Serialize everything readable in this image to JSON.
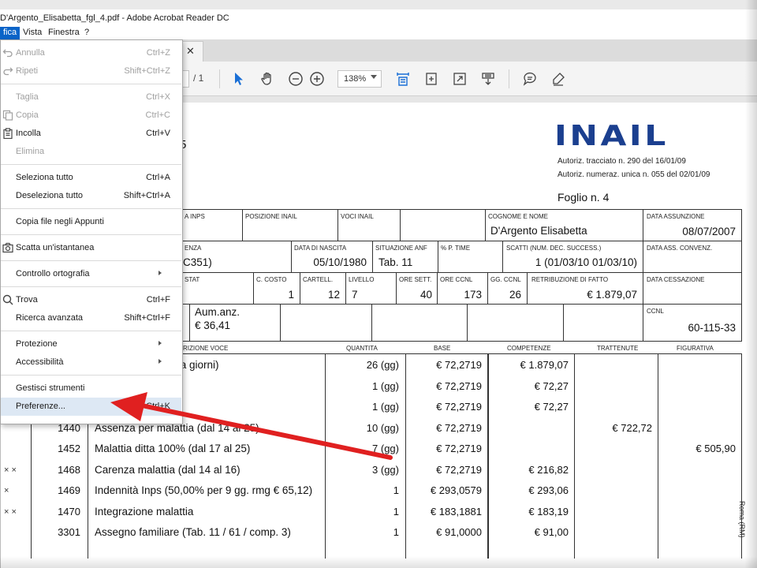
{
  "window": {
    "title": "D'Argento_Elisabetta_fgl_4.pdf - Adobe Acrobat Reader DC"
  },
  "menubar": {
    "items": [
      "fica",
      "Vista",
      "Finestra",
      "?"
    ]
  },
  "toolbar": {
    "page_total": "/ 1",
    "zoom": "138%"
  },
  "edit_menu": {
    "items": [
      {
        "label": "Annulla",
        "shortcut": "Ctrl+Z",
        "enabled": false,
        "icon": "undo-icon"
      },
      {
        "label": "Ripeti",
        "shortcut": "Shift+Ctrl+Z",
        "enabled": false,
        "icon": "redo-icon"
      },
      {
        "label": "Taglia",
        "shortcut": "Ctrl+X",
        "enabled": false
      },
      {
        "label": "Copia",
        "shortcut": "Ctrl+C",
        "enabled": false,
        "icon": "copy-icon"
      },
      {
        "label": "Incolla",
        "shortcut": "Ctrl+V",
        "enabled": true,
        "icon": "paste-icon"
      },
      {
        "label": "Elimina",
        "shortcut": "",
        "enabled": false
      },
      {
        "label": "Seleziona tutto",
        "shortcut": "Ctrl+A",
        "enabled": true
      },
      {
        "label": "Deseleziona tutto",
        "shortcut": "Shift+Ctrl+A",
        "enabled": true
      },
      {
        "label": "Copia file negli Appunti",
        "shortcut": "",
        "enabled": true
      },
      {
        "label": "Scatta un'istantanea",
        "shortcut": "",
        "enabled": true,
        "icon": "camera-icon"
      },
      {
        "label": "Controllo ortografia",
        "shortcut": "",
        "enabled": true,
        "submenu": true
      },
      {
        "label": "Trova",
        "shortcut": "Ctrl+F",
        "enabled": true,
        "icon": "search-icon"
      },
      {
        "label": "Ricerca avanzata",
        "shortcut": "Shift+Ctrl+F",
        "enabled": true
      },
      {
        "label": "Protezione",
        "shortcut": "",
        "enabled": true,
        "submenu": true
      },
      {
        "label": "Accessibilità",
        "shortcut": "",
        "enabled": true,
        "submenu": true
      },
      {
        "label": "Gestisci strumenti",
        "shortcut": "",
        "enabled": true
      },
      {
        "label": "Preferenze...",
        "shortcut": "Ctrl+K",
        "enabled": true,
        "highlighted": true
      }
    ]
  },
  "document": {
    "logo": "INAIL",
    "authorizations": [
      "Autoriz. tracciato n. 290 del 16/01/09",
      "Autoriz. numeraz. unica n. 055 del 02/01/09"
    ],
    "foglio": "Foglio n.  4",
    "left_fragment": "5",
    "header": {
      "h_inps": "A INPS",
      "h_pos_inail": "POSIZIONE INAIL",
      "h_voci_inail": "VOCI INAIL",
      "h_cognome": "COGNOME E NOME",
      "v_cognome": "D'Argento Elisabetta",
      "h_assunzione": "DATA  ASSUNZIONE",
      "v_assunzione": "08/07/2007",
      "h_enza": "ENZA",
      "v_c351": "C351)",
      "h_nascita": "DATA DI NASCITA",
      "v_nascita": "05/10/1980",
      "h_anf": "SITUAZIONE ANF",
      "v_anf": "Tab. 11",
      "h_ptime": "% P. TIME",
      "h_scatti": "SCATTI (NUM. DEC. SUCCESS.)",
      "v_scatti": "1 (01/03/10 01/03/10)",
      "h_ass_conv": "DATA ASS. CONVENZ.",
      "h_stat": "STAT",
      "h_costo": "C. COSTO",
      "v_costo": "1",
      "h_cartell": "CARTELL.",
      "v_cartell": "12",
      "h_livello": "LIVELLO",
      "v_livello": "7",
      "h_ore_sett": "ORE SETT.",
      "v_ore_sett": "40",
      "h_ore_ccnl": "ORE CCNL",
      "v_ore_ccnl": "173",
      "h_gg_ccnl": "GG. CCNL",
      "v_gg_ccnl": "26",
      "h_retribuzione": "RETRIBUZIONE DI FATTO",
      "v_retribuzione": "€ 1.879,07",
      "h_cessazione": "DATA CESSAZIONE",
      "v_aum_label": "Aum.anz.",
      "v_aum_value": "€ 36,41",
      "h_ccnl": "CCNL",
      "v_ccnl": "60-115-33"
    },
    "columns": [
      "RIZIONE VOCE",
      "QUANTITA",
      "BASE",
      "COMPETENZE",
      "TRATTENUTE",
      "FIGURATIVA"
    ],
    "rows": [
      {
        "x": "",
        "code": "",
        "desc": "aria (mensilizzata a giorni)",
        "qty": "26 (gg)",
        "base": "€ 72,2719",
        "comp": "€ 1.879,07",
        "tratt": "",
        "fig": ""
      },
      {
        "x": "",
        "code": "",
        "desc": "5 Aprile)",
        "qty": "1 (gg)",
        "base": "€ 72,2719",
        "comp": "€ 72,27",
        "tratt": "",
        "fig": ""
      },
      {
        "x": "",
        "code": "",
        "desc": "5 Aprile)",
        "qty": "1 (gg)",
        "base": "€ 72,2719",
        "comp": "€ 72,27",
        "tratt": "",
        "fig": ""
      },
      {
        "x": "",
        "code": "1440",
        "desc": "Assenza per malattia (dal 14 al 25)",
        "qty": "10 (gg)",
        "base": "€ 72,2719",
        "comp": "",
        "tratt": "€ 722,72",
        "fig": ""
      },
      {
        "x": "",
        "code": "1452",
        "desc": "Malattia ditta 100% (dal 17 al 25)",
        "qty": "7 (gg)",
        "base": "€ 72,2719",
        "comp": "",
        "tratt": "",
        "fig": "€ 505,90"
      },
      {
        "x": "× ×",
        "code": "1468",
        "desc": "Carenza malattia (dal 14 al 16)",
        "qty": "3 (gg)",
        "base": "€ 72,2719",
        "comp": "€ 216,82",
        "tratt": "",
        "fig": ""
      },
      {
        "x": "×",
        "code": "1469",
        "desc": "Indennità Inps (50,00% per 9 gg. rmg € 65,12)",
        "qty": "1",
        "base": "€ 293,0579",
        "comp": "€ 293,06",
        "tratt": "",
        "fig": ""
      },
      {
        "x": "× ×",
        "code": "1470",
        "desc": "Integrazione malattia",
        "qty": "1",
        "base": "€ 183,1881",
        "comp": "€ 183,19",
        "tratt": "",
        "fig": ""
      },
      {
        "x": "",
        "code": "3301",
        "desc": "Assegno familiare (Tab. 11 / 61 / comp. 3)",
        "qty": "1",
        "base": "€ 91,0000",
        "comp": "€ 91,00",
        "tratt": "",
        "fig": ""
      }
    ],
    "side_vertical": "Roma (RM)"
  },
  "colors": {
    "accent": "#0a64c8",
    "arrow": "#e02020",
    "logo": "#1b3f8f",
    "icon_blue": "#1a6fd6"
  }
}
